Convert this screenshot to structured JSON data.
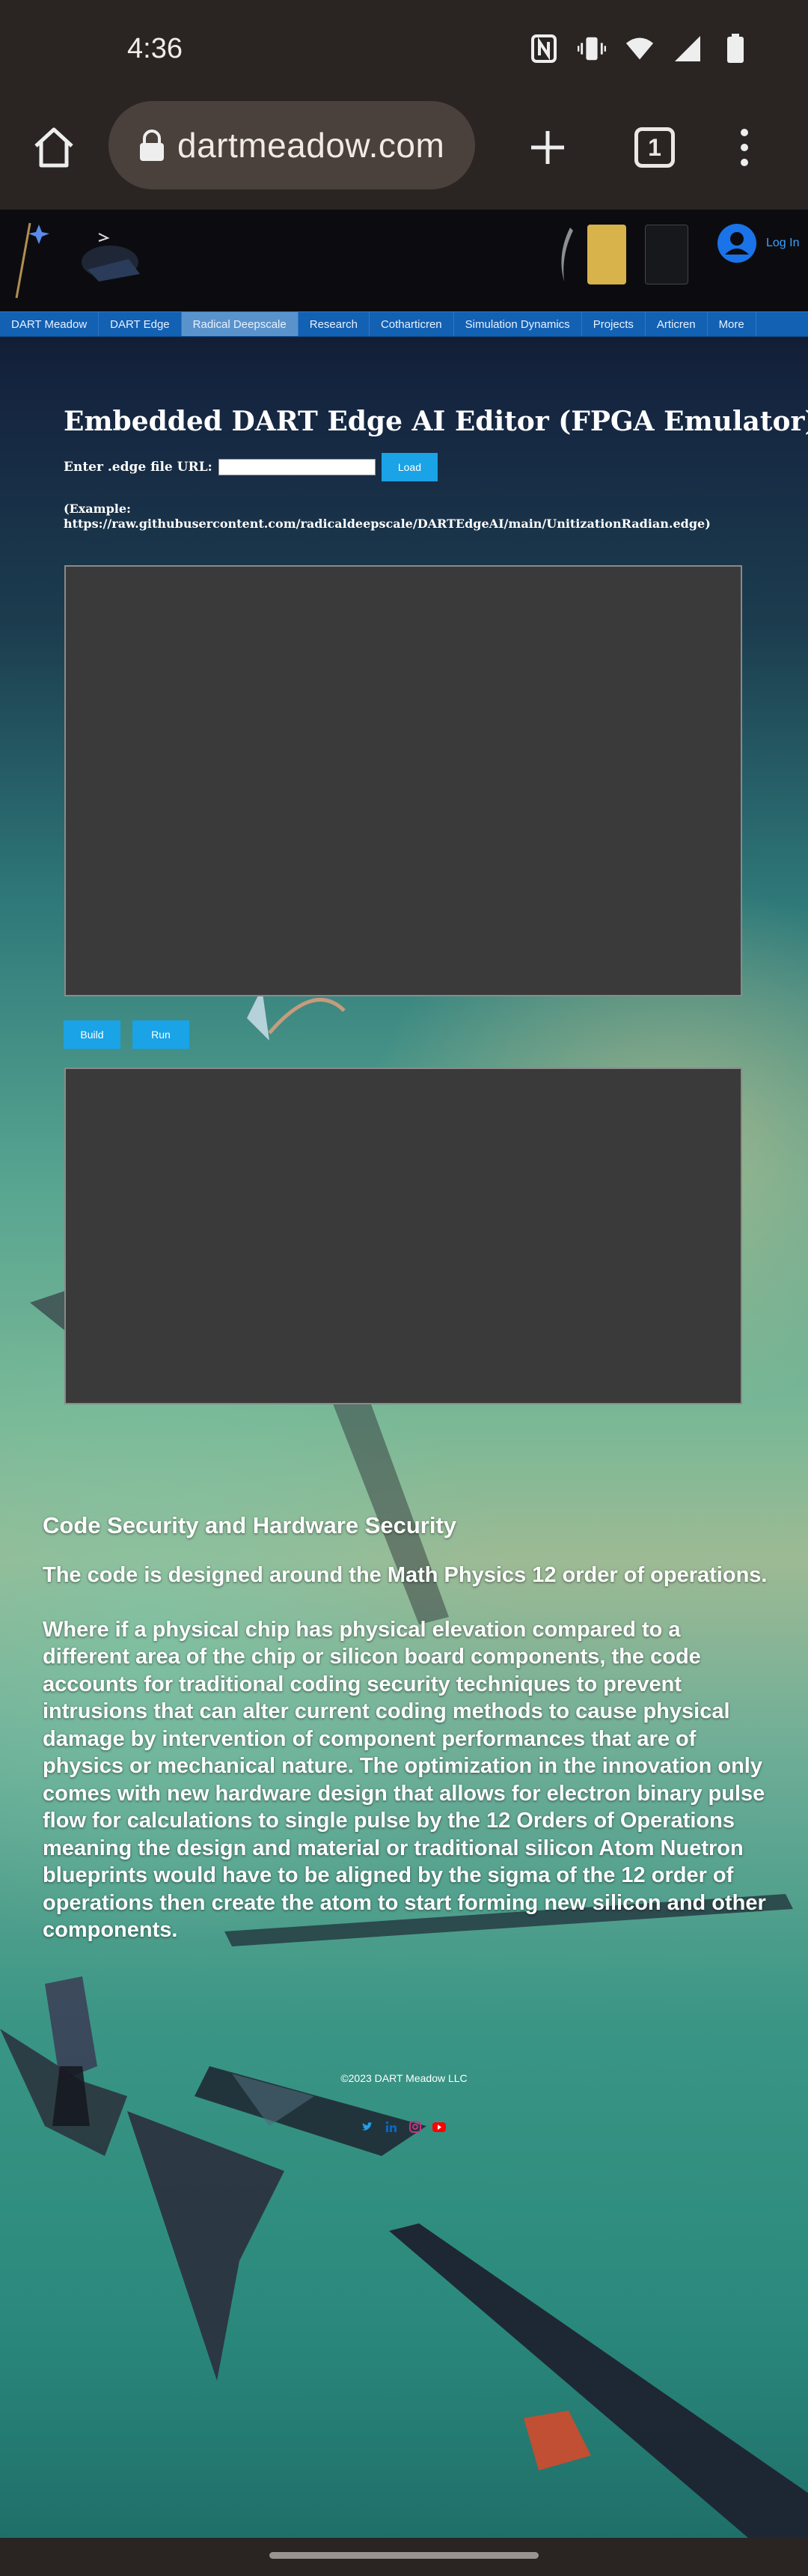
{
  "status_bar": {
    "time": "4:36",
    "icons": [
      "nfc-icon",
      "vibrate-icon",
      "wifi-icon",
      "cell-signal-icon",
      "battery-icon"
    ]
  },
  "browser": {
    "url": "dartmeadow.com",
    "tab_count": "1",
    "icons": [
      "home-icon",
      "lock-icon",
      "new-tab-icon",
      "tab-switcher-icon",
      "overflow-menu-icon"
    ]
  },
  "site_header": {
    "login_label": "Log In"
  },
  "nav": {
    "items": [
      {
        "label": "DART Meadow"
      },
      {
        "label": "DART Edge"
      },
      {
        "label": "Radical Deepscale",
        "active": true
      },
      {
        "label": "Research"
      },
      {
        "label": "Cotharticren"
      },
      {
        "label": "Simulation Dynamics"
      },
      {
        "label": "Projects"
      },
      {
        "label": "Articren"
      },
      {
        "label": "More"
      }
    ]
  },
  "editor": {
    "title": "Embedded DART Edge AI Editor (FPGA Emulator)",
    "url_label": "Enter .edge file URL:",
    "url_value": "",
    "load_label": "Load",
    "example_line1": "(Example:",
    "example_line2": "https://raw.githubusercontent.com/radicaldeepscale/DARTEdgeAI/main/UnitizationRadian.edge)",
    "build_label": "Build",
    "run_label": "Run"
  },
  "article": {
    "heading": "Code Security and Hardware Security",
    "p1": "The code is designed around the Math Physics 12 order of operations.",
    "p2": "Where if a physical chip has physical elevation compared to a different area of the chip or silicon board components, the code accounts for traditional coding security techniques to prevent intrusions that can alter current coding methods to cause physical damage by intervention of component performances that are of physics or mechanical nature. The optimization in the innovation only comes with new hardware design that allows for electron binary pulse flow for calculations to single pulse by the 12 Orders of Operations meaning the design and material or traditional silicon Atom Nuetron blueprints would have to be aligned by the sigma of the 12 order of operations then create the atom to start forming new silicon and other components."
  },
  "footer": {
    "copyright": "©2023 DART Meadow LLC",
    "social_icons": [
      "twitter-icon",
      "linkedin-icon",
      "instagram-icon",
      "youtube-icon"
    ],
    "colors": {
      "twitter": "#1da1f2",
      "linkedin": "#0a66c2",
      "instagram": "#c13584",
      "youtube": "#ff0000"
    }
  },
  "colors": {
    "nav_bg": "#1361b3",
    "button_bg": "#1aa3e6",
    "panel_bg": "#3a3a3a",
    "chrome_bg": "#2a2523"
  }
}
